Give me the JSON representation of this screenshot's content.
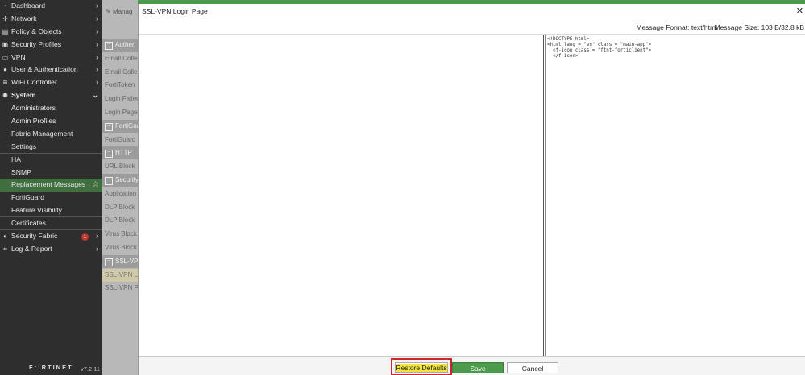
{
  "sidebar": {
    "items": [
      {
        "label": "Dashboard",
        "icon": "dashboard-icon",
        "glyph": "◔",
        "chevron": "›"
      },
      {
        "label": "Network",
        "icon": "network-icon",
        "glyph": "✢",
        "chevron": "›"
      },
      {
        "label": "Policy & Objects",
        "icon": "policy-icon",
        "glyph": "▤",
        "chevron": "›"
      },
      {
        "label": "Security Profiles",
        "icon": "lock-icon",
        "glyph": "▣",
        "chevron": "›"
      },
      {
        "label": "VPN",
        "icon": "vpn-icon",
        "glyph": "▭",
        "chevron": "›"
      },
      {
        "label": "User & Authentication",
        "icon": "user-icon",
        "glyph": "●",
        "chevron": "›"
      },
      {
        "label": "WiFi Controller",
        "icon": "wifi-icon",
        "glyph": "≋",
        "chevron": "›"
      },
      {
        "label": "System",
        "icon": "gear-icon",
        "glyph": "✹",
        "chevron": "⌄"
      },
      {
        "label": "Administrators"
      },
      {
        "label": "Admin Profiles"
      },
      {
        "label": "Fabric Management"
      },
      {
        "label": "Settings"
      },
      {
        "label": "HA"
      },
      {
        "label": "SNMP"
      },
      {
        "label": "Replacement Messages",
        "star": "☆"
      },
      {
        "label": "FortiGuard"
      },
      {
        "label": "Feature Visibility"
      },
      {
        "label": "Certificates"
      },
      {
        "label": "Security Fabric",
        "icon": "security-fabric-icon",
        "glyph": "◐",
        "chevron": "›",
        "badge": "1"
      },
      {
        "label": "Log & Report",
        "icon": "report-icon",
        "glyph": "⌗",
        "chevron": "›"
      }
    ],
    "logo": "F::RTINET",
    "version": "v7.2.11"
  },
  "background": {
    "manage_label": "Manag",
    "rows": [
      {
        "label": "Authen",
        "group": true
      },
      {
        "label": "Email Collec"
      },
      {
        "label": "Email Collec"
      },
      {
        "label": "FortiToken"
      },
      {
        "label": "Login Failed"
      },
      {
        "label": "Login Page"
      },
      {
        "label": "FortiGua",
        "group": true
      },
      {
        "label": "FortiGuard"
      },
      {
        "label": "HTTP",
        "group": true
      },
      {
        "label": "URL Block"
      },
      {
        "label": "Security",
        "group": true
      },
      {
        "label": "Application"
      },
      {
        "label": "DLP Block"
      },
      {
        "label": "DLP Block"
      },
      {
        "label": "Virus Block"
      },
      {
        "label": "Virus Block"
      },
      {
        "label": "SSL-VPN",
        "group": true
      },
      {
        "label": "SSL-VPN Lo",
        "highlight": true
      },
      {
        "label": "SSL-VPN Po"
      }
    ]
  },
  "dialog": {
    "title": "SSL-VPN Login Page",
    "close": "✕",
    "message_format": "Message Format: text/html",
    "message_size": "Message Size: 103 B/32.8 kB",
    "code_lines": [
      "<!DOCTYPE html>",
      "<html lang = \"en\" class = \"main-app\">",
      "  <f-icon class = \"ftnt-forticlient\">",
      "  </f-icon>"
    ],
    "buttons": {
      "restore": "Restore Defaults",
      "save": "Save",
      "cancel": "Cancel"
    }
  },
  "colors": {
    "accent": "#4c9a4c",
    "highlight_box": "#d0242b",
    "text_highlight": "#f2e43b"
  }
}
